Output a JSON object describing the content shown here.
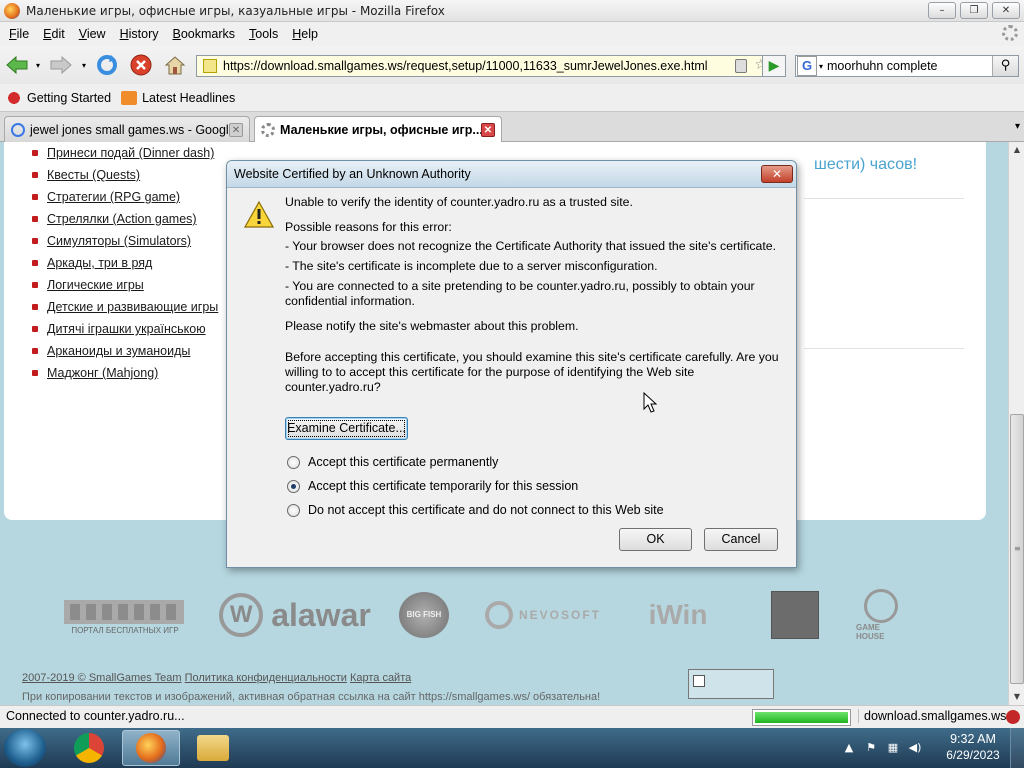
{
  "window": {
    "title": "Маленькие игры, офисные игры, казуальные игры - Mozilla Firefox",
    "buttons": [
      "–",
      "❐",
      "✕"
    ]
  },
  "menu": [
    "File",
    "Edit",
    "View",
    "History",
    "Bookmarks",
    "Tools",
    "Help"
  ],
  "nav": {
    "url": "https://download.smallgames.ws/request,setup/11000,11633_sumrJewelJones.exe.html",
    "search_engine": "G",
    "search_query": "moorhuhn complete"
  },
  "bookmarks": [
    {
      "label": "Getting Started",
      "icon": "firefox-icon"
    },
    {
      "label": "Latest Headlines",
      "icon": "rss-icon"
    }
  ],
  "tabs": [
    {
      "label": "jewel jones small games.ws - Googl...",
      "active": false
    },
    {
      "label": "Маленькие игры, офисные игр...",
      "active": true
    }
  ],
  "page": {
    "categories": [
      "Принеси подай (Dinner dash)",
      "Квесты (Quests)",
      "Стратегии (RPG game)",
      "Стрелялки (Action games)",
      "Симуляторы (Simulators)",
      "Аркады, три в ряд",
      "Логические игры",
      "Детские и развивающие игры",
      "Дитячі іграшки українською",
      "Арканоиды и зуманоиды",
      "Маджонг (Mahjong)"
    ],
    "behind_text": "шести) часов!",
    "partners": [
      "ПОРТАЛ БЕСПЛАТНЫХ ИГР",
      "alawar",
      "BIG FISH",
      "NEVOSOFT",
      "iWin",
      "",
      "GAME HOUSE"
    ],
    "footer_copyright": "2007-2019 © SmallGames Team",
    "footer_privacy": "Политика конфиденциальности",
    "footer_sitemap": "Карта сайта",
    "footer_note": "При копировании текстов и изображений, активная обратная ссылка на сайт https://smallgames.ws/ обязательна!"
  },
  "dialog": {
    "title": "Website Certified by an Unknown Authority",
    "line1": "Unable to verify the identity of counter.yadro.ru as a trusted site.",
    "reasons_heading": "Possible reasons for this error:",
    "reason1": "- Your browser does not recognize the Certificate Authority that issued the site's certificate.",
    "reason2": "- The site's certificate is incomplete due to a server misconfiguration.",
    "reason3": "- You are connected to a site pretending to be counter.yadro.ru, possibly to obtain your confidential information.",
    "notify": "Please notify the site's webmaster about this problem.",
    "before": "Before accepting this certificate, you should examine this site's certificate carefully. Are you willing to to accept this certificate for the purpose of identifying the Web site counter.yadro.ru?",
    "examine_btn": "Examine Certificate...",
    "options": [
      {
        "label": "Accept this certificate permanently",
        "checked": false
      },
      {
        "label": "Accept this certificate temporarily for this session",
        "checked": true
      },
      {
        "label": "Do not accept this certificate and do not connect to this Web site",
        "checked": false
      }
    ],
    "ok_btn": "OK",
    "cancel_btn": "Cancel"
  },
  "status": {
    "text": "Connected to counter.yadro.ru...",
    "progress": 1.0,
    "host": "download.smallgames.ws"
  },
  "taskbar": {
    "apps": [
      "chrome-icon",
      "firefox-icon",
      "explorer-icon"
    ],
    "time": "9:32 AM",
    "date": "6/29/2023"
  }
}
